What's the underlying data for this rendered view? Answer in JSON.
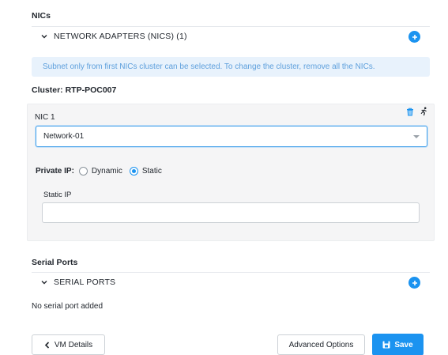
{
  "nics": {
    "section_title": "NICs",
    "collapse_label": "NETWORK ADAPTERS (NICS) (1)",
    "info_banner": "Subnet only from first NICs cluster can be selected. To change the cluster, remove all the NICs.",
    "cluster_label": "Cluster: RTP-POC007",
    "card": {
      "title": "NIC 1",
      "network_value": "Network-01",
      "private_ip_label": "Private IP:",
      "ip_mode_options": [
        "Dynamic",
        "Static"
      ],
      "ip_mode_selected": "Static",
      "static_ip_label": "Static IP",
      "static_ip_value": "",
      "delete_icon": "trash-icon",
      "auto_icon": "running-person-icon"
    }
  },
  "serial_ports": {
    "section_title": "Serial Ports",
    "collapse_label": "SERIAL PORTS",
    "empty_text": "No serial port added"
  },
  "footer": {
    "back_label": "VM Details",
    "advanced_label": "Advanced Options",
    "save_label": "Save"
  },
  "colors": {
    "accent": "#1b93f0",
    "banner_bg": "#e8f2fc",
    "banner_text": "#5d9fdc",
    "card_bg": "#f5f5f6"
  }
}
